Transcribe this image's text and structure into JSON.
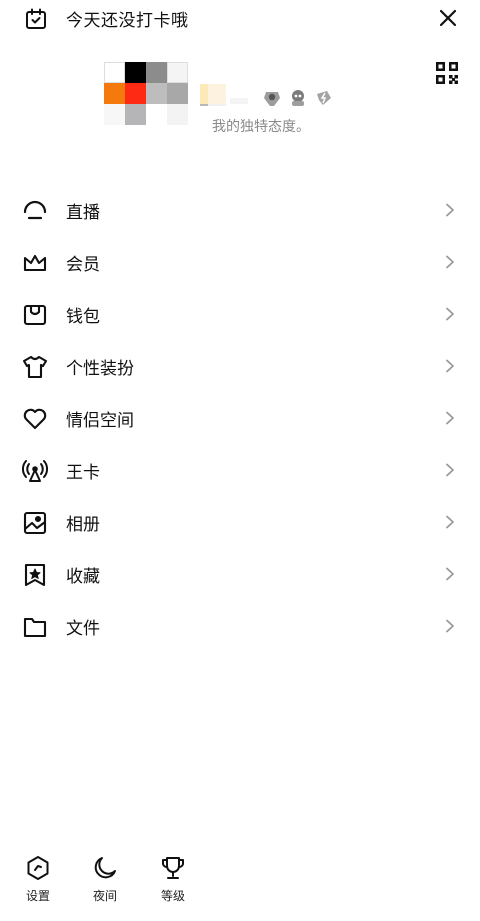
{
  "header": {
    "checkin_text": "今天还没打卡哦"
  },
  "profile": {
    "signature": "我的独特态度。"
  },
  "menu": {
    "items": [
      {
        "label": "直播",
        "icon": "live-icon"
      },
      {
        "label": "会员",
        "icon": "crown-icon"
      },
      {
        "label": "钱包",
        "icon": "wallet-icon"
      },
      {
        "label": "个性装扮",
        "icon": "tshirt-icon"
      },
      {
        "label": "情侣空间",
        "icon": "heart-icon"
      },
      {
        "label": "王卡",
        "icon": "signal-tower-icon"
      },
      {
        "label": "相册",
        "icon": "photo-album-icon"
      },
      {
        "label": "收藏",
        "icon": "bookmark-star-icon"
      },
      {
        "label": "文件",
        "icon": "folder-icon"
      }
    ]
  },
  "bottom_bar": {
    "settings_label": "设置",
    "night_label": "夜间",
    "level_label": "等级"
  },
  "colors": {
    "text": "#111111",
    "muted": "#8a8a8a",
    "chevron": "#9a9a9a"
  }
}
